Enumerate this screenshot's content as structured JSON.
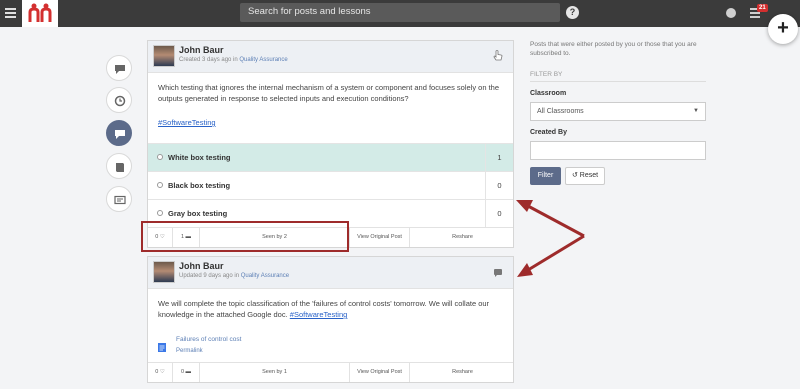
{
  "topbar": {
    "search_placeholder": "Search for posts and lessons",
    "help_glyph": "?",
    "notification_count": "21",
    "add_glyph": "+"
  },
  "posts": [
    {
      "author": "John Baur",
      "meta_prefix": "Created 3 days ago in ",
      "classroom": "Quality Assurance",
      "question": "Which testing that ignores the internal mechanism of a system or component and focuses solely on the outputs generated in response to selected inputs and execution conditions?",
      "hashtag": "#SoftwareTesting",
      "options": [
        {
          "label": "White box testing",
          "count": "1"
        },
        {
          "label": "Black box testing",
          "count": "0"
        },
        {
          "label": "Gray box testing",
          "count": "0"
        }
      ],
      "footer": {
        "likes": "0",
        "comments": "1",
        "seen": "Seen by 2",
        "view_original": "View Original Post",
        "reshare": "Reshare"
      }
    },
    {
      "author": "John Baur",
      "meta_prefix": "Updated 9 days ago in ",
      "classroom": "Quality Assurance",
      "body": "We will complete the topic classification of the 'failures of control costs' tomorrow. We will collate our knowledge in the attached Google doc.",
      "hashtag": "#SoftwareTesting",
      "attachment_title": "Failures of control cost",
      "attachment_link": "Permalink",
      "footer": {
        "likes": "0",
        "comments": "0",
        "seen": "Seen by 1",
        "view_original": "View Original Post",
        "reshare": "Reshare"
      }
    }
  ],
  "right_panel": {
    "description": "Posts that were either posted by you or those that you are subscribed to.",
    "filter_by": "FILTER BY",
    "classroom_label": "Classroom",
    "classroom_value": "All Classrooms",
    "created_by_label": "Created By",
    "filter_button": "Filter",
    "reset_button": "Reset"
  },
  "colors": {
    "topbar": "#3b3b3b",
    "accent": "#5c6b8a",
    "highlight_option": "#d3ebe7",
    "annotation_red": "#9e2b2b",
    "logo_red": "#d32f2f"
  },
  "icons": [
    "menu-icon",
    "logo-icon",
    "help-icon",
    "globe-icon",
    "notifications-icon",
    "add-icon",
    "chat-icon",
    "clock-icon",
    "posts-icon",
    "book-icon",
    "card-icon",
    "pointer-icon",
    "comment-icon",
    "doc-icon"
  ]
}
